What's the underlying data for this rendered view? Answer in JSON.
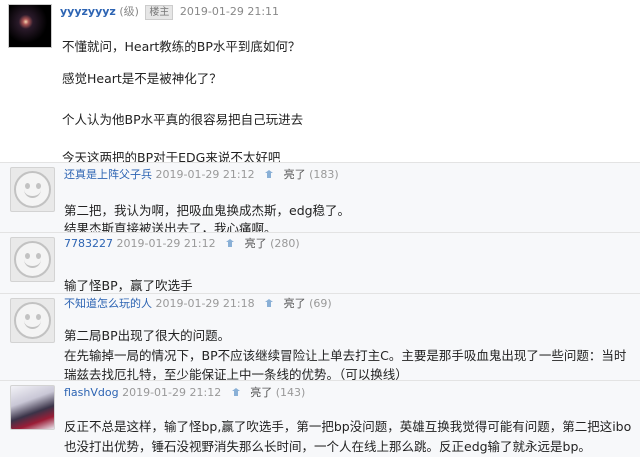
{
  "post": {
    "username": "yyyzyyyz",
    "level": "(级)",
    "badge": "楼主",
    "timestamp": "2019-01-29 21:11",
    "lines": [
      "不懂就问，Heart教练的BP水平到底如何？",
      "感觉Heart是不是被神化了？",
      "个人认为他BP水平真的很容易把自己玩进去",
      "今天这两把的BP对于EDG来说不太好吧"
    ]
  },
  "replies": [
    {
      "username": "还真是上阵父子兵",
      "timestamp": "2019-01-29 21:12",
      "light_label": "亮了",
      "light_count": "(183)",
      "lines": [
        "第二把，我认为啊，把吸血鬼换成杰斯，edg稳了。",
        "结果杰斯直接被送出去了，我心痛啊。"
      ]
    },
    {
      "username": "7783227",
      "timestamp": "2019-01-29 21:12",
      "light_label": "亮了",
      "light_count": "(280)",
      "lines": [
        "输了怪BP，赢了吹选手"
      ]
    },
    {
      "username": "不知道怎么玩的人",
      "timestamp": "2019-01-29 21:18",
      "light_label": "亮了",
      "light_count": "(69)",
      "lines": [
        "第二局BP出现了很大的问题。",
        "在先输掉一局的情况下，BP不应该继续冒险让上单去打主C。主要是那手吸血鬼出现了一些问题：当时",
        "瑞兹去找厄扎特，至少能保证上中一条线的优势。（可以换线）"
      ]
    },
    {
      "username": "flashVdog",
      "timestamp": "2019-01-29 21:12",
      "light_label": "亮了",
      "light_count": "(143)",
      "lines": [
        "反正不总是这样，输了怪bp,赢了吹选手，第一把bp没问题，英雄互换我觉得可能有问题，第二把这ibo",
        "也没打出优势，锤石没视野消失那么长时间，一个人在线上那么跳。反正edg输了就永远是bp。"
      ]
    }
  ]
}
